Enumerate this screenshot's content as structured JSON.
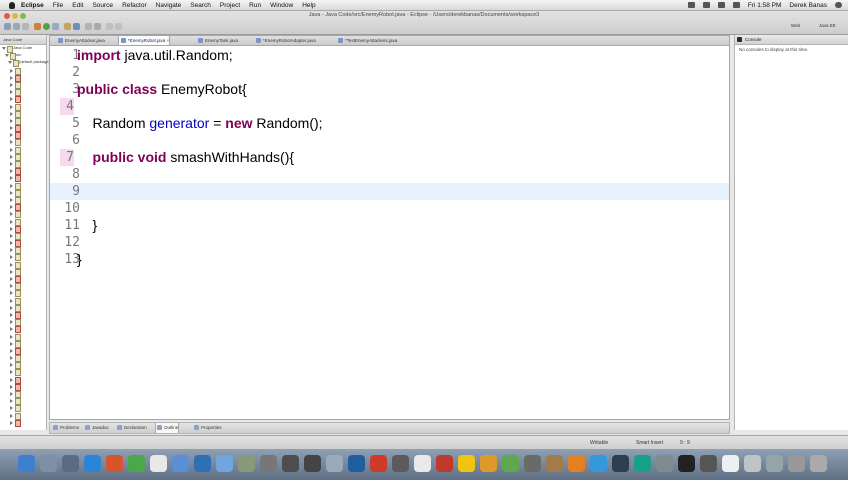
{
  "menubar": {
    "items": [
      "Eclipse",
      "File",
      "Edit",
      "Source",
      "Refactor",
      "Navigate",
      "Search",
      "Project",
      "Run",
      "Window",
      "Help"
    ],
    "clock": "Fri 1:58 PM",
    "user": "Derek Banas"
  },
  "window": {
    "title": "Java - Java Code/src/EnemyRobot.java - Eclipse - /Users/derekbanas/Documents/workspace3"
  },
  "explorer": {
    "header": "Java Code",
    "items": [
      "Java Code",
      "src",
      "(default package)"
    ]
  },
  "editor": {
    "tabs": [
      {
        "label": "EnemyAttacker.java",
        "active": false
      },
      {
        "label": "*EnemyRobot.java",
        "active": true
      },
      {
        "label": "EnemyTank.java",
        "active": false
      },
      {
        "label": "*EnemyRobotAdapter.java",
        "active": false
      },
      {
        "label": "*TestEnemyAttackers.java",
        "active": false
      }
    ],
    "current_line": 9,
    "highlighted_lines": [
      4,
      7
    ],
    "lines": [
      {
        "num": "1",
        "code": [
          {
            "t": "import ",
            "k": "kw"
          },
          {
            "t": "java.util.Random;",
            "k": ""
          }
        ]
      },
      {
        "num": "2",
        "code": []
      },
      {
        "num": "3",
        "code": [
          {
            "t": "public class ",
            "k": "kw"
          },
          {
            "t": "EnemyRobot{",
            "k": ""
          }
        ]
      },
      {
        "num": "4",
        "code": []
      },
      {
        "num": "5",
        "code": [
          {
            "t": "    Random ",
            "k": ""
          },
          {
            "t": "generator",
            "k": "fld"
          },
          {
            "t": " = ",
            "k": ""
          },
          {
            "t": "new ",
            "k": "kw"
          },
          {
            "t": "Random();",
            "k": ""
          }
        ]
      },
      {
        "num": "6",
        "code": []
      },
      {
        "num": "7",
        "code": [
          {
            "t": "    public void ",
            "k": "kw"
          },
          {
            "t": "smashWithHands(){",
            "k": ""
          }
        ]
      },
      {
        "num": "8",
        "code": []
      },
      {
        "num": "9",
        "code": []
      },
      {
        "num": "10",
        "code": []
      },
      {
        "num": "11",
        "code": [
          {
            "t": "    }",
            "k": ""
          }
        ]
      },
      {
        "num": "12",
        "code": []
      },
      {
        "num": "13",
        "code": [
          {
            "t": "}",
            "k": ""
          }
        ]
      }
    ]
  },
  "console": {
    "tab_label": "Console",
    "message": "No consoles to display at this time.",
    "perspectives": [
      "Web",
      "Java EE"
    ]
  },
  "bottom_tabs": [
    "Problems",
    "Javadoc",
    "Declaration",
    "Outline",
    "Properties"
  ],
  "bottom_active": "Outline",
  "status": {
    "writable": "Writable",
    "insert_mode": "Smart Insert",
    "position": "9 : 9"
  },
  "colors": {
    "keyword": "#7f0055",
    "field": "#0000c0",
    "current_line": "#e8f2fe",
    "line_marker": "#f5d9ee"
  }
}
